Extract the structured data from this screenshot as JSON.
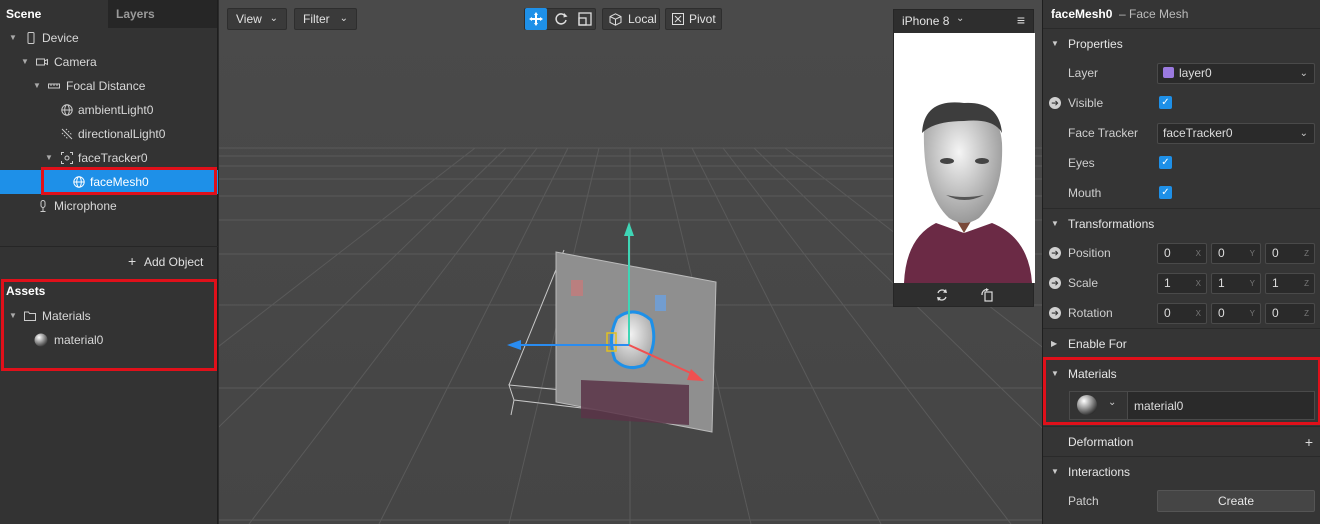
{
  "scene_panel": {
    "tabs": [
      "Scene",
      "Layers"
    ],
    "tree": [
      {
        "label": "Device",
        "icon": "device-icon"
      },
      {
        "label": "Camera",
        "icon": "camera-icon"
      },
      {
        "label": "Focal Distance",
        "icon": "focal-distance-icon"
      },
      {
        "label": "ambientLight0",
        "icon": "globe-icon"
      },
      {
        "label": "directionalLight0",
        "icon": "directional-light-icon"
      },
      {
        "label": "faceTracker0",
        "icon": "face-tracker-icon"
      },
      {
        "label": "faceMesh0",
        "icon": "mesh-icon",
        "selected": true
      },
      {
        "label": "Microphone",
        "icon": "microphone-icon"
      }
    ],
    "add_object": "Add Object"
  },
  "assets_panel": {
    "title": "Assets",
    "items": [
      {
        "label": "Materials",
        "icon": "folder-icon"
      },
      {
        "label": "material0",
        "icon": "material-sphere-icon"
      }
    ]
  },
  "viewport": {
    "view_label": "View",
    "filter_label": "Filter",
    "tools": [
      "move-icon",
      "rotate-icon",
      "scale-icon"
    ],
    "local_label": "Local",
    "pivot_label": "Pivot",
    "device_name": "iPhone 8"
  },
  "inspector": {
    "title": "faceMesh0",
    "subtitle": "– Face Mesh",
    "properties_label": "Properties",
    "layer_label": "Layer",
    "layer_value": "layer0",
    "layer_color": "#9b7ae0",
    "visible_label": "Visible",
    "face_tracker_label": "Face Tracker",
    "face_tracker_value": "faceTracker0",
    "eyes_label": "Eyes",
    "mouth_label": "Mouth",
    "transformations_label": "Transformations",
    "position_label": "Position",
    "position": [
      "0",
      "0",
      "0"
    ],
    "scale_label": "Scale",
    "scale": [
      "1",
      "1",
      "1"
    ],
    "rotation_label": "Rotation",
    "rotation": [
      "0",
      "0",
      "0"
    ],
    "axes": [
      "X",
      "Y",
      "Z"
    ],
    "enable_for_label": "Enable For",
    "materials_label": "Materials",
    "material_value": "material0",
    "deformation_label": "Deformation",
    "interactions_label": "Interactions",
    "patch_label": "Patch",
    "create_label": "Create"
  },
  "accent_color": "#1e90e8",
  "highlight_color": "#e0101a"
}
